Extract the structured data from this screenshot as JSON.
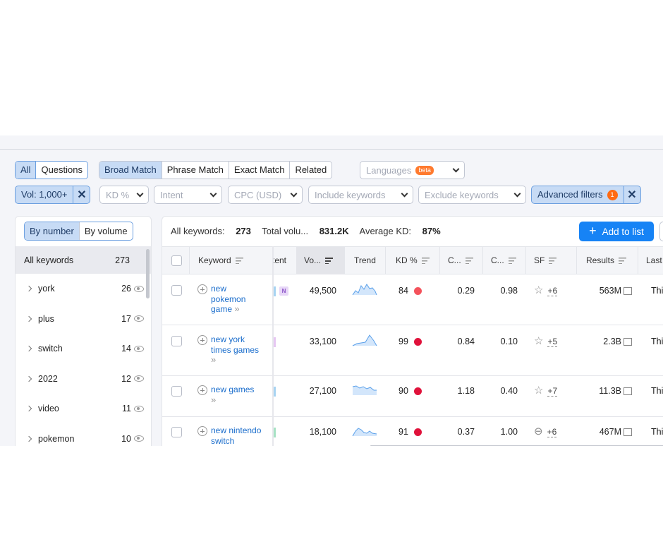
{
  "match_tabs": {
    "type_tabs": [
      "All",
      "Questions"
    ],
    "match_types": [
      "Broad Match",
      "Phrase Match",
      "Exact Match",
      "Related"
    ],
    "languages": {
      "label": "Languages",
      "badge": "beta"
    }
  },
  "filters": {
    "volume_chip": "Vol: 1,000+",
    "kd": "KD %",
    "intent": "Intent",
    "cpc": "CPC (USD)",
    "include": "Include keywords",
    "exclude": "Exclude keywords",
    "advanced": "Advanced filters",
    "advanced_count": "1"
  },
  "left_panel": {
    "toggle": [
      "By number",
      "By volume"
    ],
    "all_label": "All keywords",
    "all_count": "273",
    "groups": [
      {
        "name": "york",
        "count": "26"
      },
      {
        "name": "plus",
        "count": "17"
      },
      {
        "name": "switch",
        "count": "14"
      },
      {
        "name": "2022",
        "count": "12"
      },
      {
        "name": "video",
        "count": "11"
      },
      {
        "name": "pokemon",
        "count": "10"
      }
    ]
  },
  "summary": {
    "all_label": "All keywords:",
    "all_value": "273",
    "total_label": "Total volu...",
    "total_value": "831.2K",
    "avg_label": "Average KD:",
    "avg_value": "87%",
    "add_button": "Add to list"
  },
  "table": {
    "headers": {
      "keyword": "Keyword",
      "intent": "tent",
      "volume": "Vo...",
      "trend": "Trend",
      "kd": "KD %",
      "cpc": "C...",
      "com": "C...",
      "sf": "SF",
      "results": "Results",
      "last": "Last"
    },
    "rows": [
      {
        "keyword": "new pokemon game",
        "intent": "N",
        "volume": "49,500",
        "kd": "84",
        "cpc": "0.29",
        "com": "0.98",
        "sf": "+6",
        "results": "563M",
        "last": "Thi"
      },
      {
        "keyword": "new york times games",
        "intent": "",
        "volume": "33,100",
        "kd": "99",
        "cpc": "0.84",
        "com": "0.10",
        "sf": "+5",
        "results": "2.3B",
        "last": "Thi"
      },
      {
        "keyword": "new games",
        "intent": "",
        "volume": "27,100",
        "kd": "90",
        "cpc": "1.18",
        "com": "0.40",
        "sf": "+7",
        "results": "11.3B",
        "last": "Thi"
      },
      {
        "keyword": "new nintendo switch",
        "intent": "",
        "volume": "18,100",
        "kd": "91",
        "cpc": "0.37",
        "com": "1.00",
        "sf": "+6",
        "results": "467M",
        "last": "Thi"
      }
    ]
  },
  "colors": {
    "accent": "#1683f5",
    "selected": "#c7dbf5",
    "kd_dot": "#e0123b",
    "link": "#1a6dcc"
  }
}
